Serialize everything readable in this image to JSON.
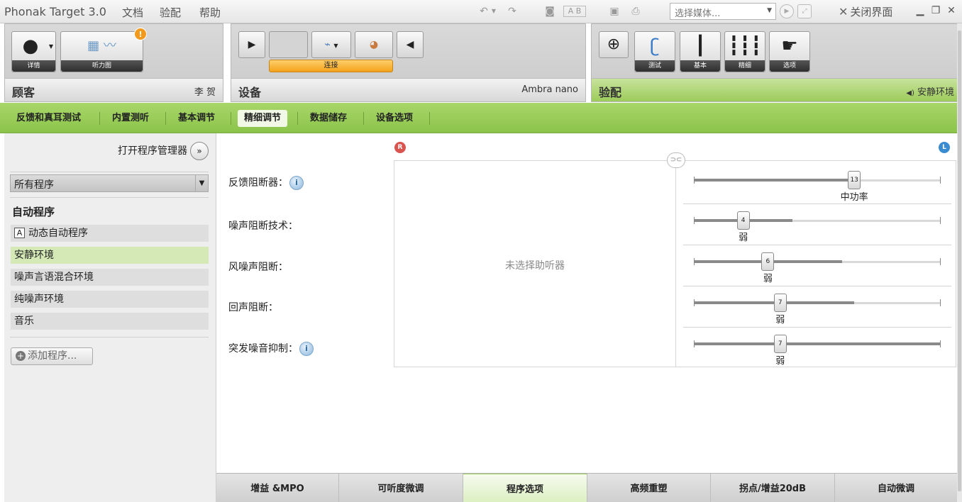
{
  "menubar": {
    "app_title": "Phonak Target 3.0",
    "menus": [
      "文档",
      "验配",
      "帮助"
    ],
    "media_select_placeholder": "选择媒体...",
    "close_label": "关闭界面",
    "ab_label": "A B"
  },
  "client_panel": {
    "details_label": "详情",
    "audiogram_label": "听力图",
    "badge": "!",
    "title": "顾客",
    "client_name": "李 贺"
  },
  "device_panel": {
    "connect_label": "连接",
    "title": "设备",
    "device_name": "Ambra nano"
  },
  "fit_panel": {
    "buttons": [
      "测试",
      "基本",
      "精细",
      "选项"
    ],
    "title": "验配",
    "program_indicator": "安静环境"
  },
  "subnav": {
    "items": [
      "反馈和真耳测试",
      "内置测听",
      "基本调节",
      "精细调节",
      "数据储存",
      "设备选项"
    ],
    "active_index": 3
  },
  "sidebar": {
    "open_manager": "打开程序管理器",
    "program_filter": "所有程序",
    "auto_heading": "自动程序",
    "auto_program": "动态自动程序",
    "auto_icon": "A",
    "programs": [
      "安静环境",
      "噪声言语混合环境",
      "纯噪声环境",
      "音乐"
    ],
    "active_program": "安静环境",
    "add_program": "添加程序..."
  },
  "main": {
    "right_ear_letter": "R",
    "left_ear_letter": "L",
    "no_device_message": "未选择助听器",
    "features": [
      {
        "label": "反馈阻断器：",
        "info": true,
        "value": 13,
        "value_text": "中功率",
        "fill_to": 13
      },
      {
        "label": "噪声阻断技术：",
        "info": false,
        "value": 4,
        "value_text": "弱",
        "fill_to": 8
      },
      {
        "label": "风噪声阻断：",
        "info": false,
        "value": 6,
        "value_text": "弱",
        "fill_to": 12
      },
      {
        "label": "回声阻断：",
        "info": false,
        "value": 7,
        "value_text": "弱",
        "fill_to": 13
      },
      {
        "label": "突发噪音抑制：",
        "info": true,
        "value": 7,
        "value_text": "弱",
        "fill_to": 20
      }
    ],
    "slider_max": 20
  },
  "bottom_tabs": {
    "items": [
      "增益 &MPO",
      "可听度微调",
      "程序选项",
      "高频重塑",
      "拐点/增益20dB",
      "自动微调"
    ],
    "active_index": 2
  },
  "colors": {
    "accent_green": "#9ccb5a",
    "connect_orange": "#f3a21b",
    "right_ear_red": "#d9534f",
    "left_ear_blue": "#3b8bd0"
  }
}
